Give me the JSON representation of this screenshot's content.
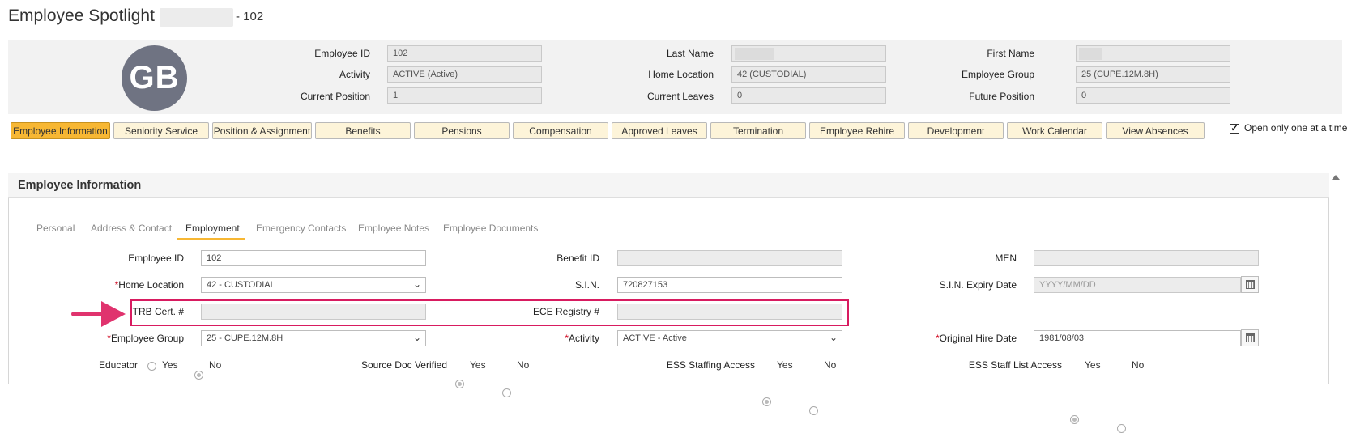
{
  "header": {
    "title": "Employee Spotlight",
    "title_suffix": "- 102"
  },
  "summary": {
    "avatar_initials": "GB",
    "fields": [
      {
        "label": "Employee ID",
        "value": "102"
      },
      {
        "label": "Activity",
        "value": "ACTIVE (Active)"
      },
      {
        "label": "Current Position",
        "value": "1"
      },
      {
        "label": "Last Name",
        "value": ""
      },
      {
        "label": "Home Location",
        "value": "42 (CUSTODIAL)"
      },
      {
        "label": "Current Leaves",
        "value": "0"
      },
      {
        "label": "First Name",
        "value": ""
      },
      {
        "label": "Employee Group",
        "value": "25 (CUPE.12M.8H)"
      },
      {
        "label": "Future Position",
        "value": "0"
      }
    ]
  },
  "module_tabs": [
    {
      "label": "Employee Information",
      "active": true
    },
    {
      "label": "Seniority Service"
    },
    {
      "label": "Position & Assignment"
    },
    {
      "label": "Benefits"
    },
    {
      "label": "Pensions"
    },
    {
      "label": "Compensation"
    },
    {
      "label": "Approved Leaves"
    },
    {
      "label": "Termination"
    },
    {
      "label": "Employee Rehire"
    },
    {
      "label": "Development"
    },
    {
      "label": "Work Calendar"
    },
    {
      "label": "View Absences"
    }
  ],
  "open_one": {
    "label": "Open only one at a time",
    "checked": true
  },
  "section": {
    "title": "Employee Information"
  },
  "sub_tabs": [
    {
      "label": "Personal"
    },
    {
      "label": "Address & Contact"
    },
    {
      "label": "Employment",
      "active": true
    },
    {
      "label": "Emergency Contacts"
    },
    {
      "label": "Employee Notes"
    },
    {
      "label": "Employee Documents"
    }
  ],
  "form": {
    "employee_id": {
      "label": "Employee ID",
      "value": "102"
    },
    "benefit_id": {
      "label": "Benefit ID",
      "value": ""
    },
    "men": {
      "label": "MEN",
      "value": ""
    },
    "home_location": {
      "label": "Home Location",
      "value": "42 - CUSTODIAL"
    },
    "sin": {
      "label": "S.I.N.",
      "value": "720827153"
    },
    "sin_expiry": {
      "label": "S.I.N. Expiry Date",
      "placeholder": "YYYY/MM/DD"
    },
    "trb_cert": {
      "label": "TRB Cert. #",
      "value": ""
    },
    "ece_registry": {
      "label": "ECE Registry #",
      "value": ""
    },
    "employee_group": {
      "label": "Employee Group",
      "value": "25 - CUPE.12M.8H"
    },
    "activity": {
      "label": "Activity",
      "value": "ACTIVE - Active"
    },
    "original_hire": {
      "label": "Original Hire Date",
      "value": "1981/08/03"
    },
    "required_mark": "*",
    "yes": "Yes",
    "no": "No",
    "educator": {
      "label": "Educator",
      "selected": "No"
    },
    "source_doc": {
      "label": "Source Doc Verified",
      "selected": "Yes"
    },
    "ess_staffing": {
      "label": "ESS Staffing Access",
      "selected": "Yes"
    },
    "ess_staff_list": {
      "label": "ESS Staff List Access",
      "selected": "Yes"
    }
  },
  "icons": {
    "chevron": "chevron-down-icon",
    "calendar": "calendar-icon",
    "check": "check-icon"
  }
}
